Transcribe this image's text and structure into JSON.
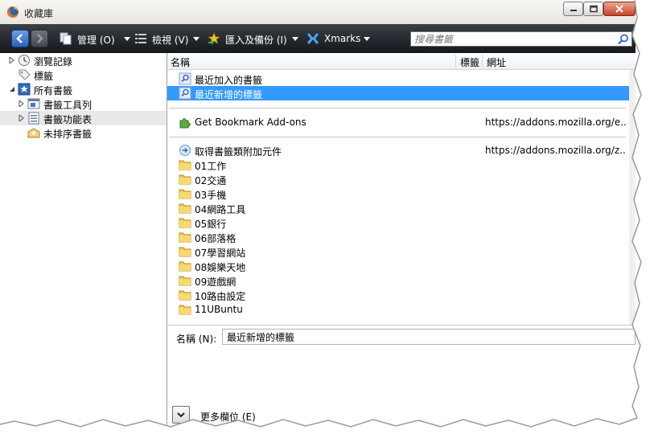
{
  "window": {
    "title": "收藏庫",
    "app_icon": "firefox-icon",
    "controls": [
      "minimize-icon",
      "maximize-icon",
      "close-icon"
    ]
  },
  "toolbar": {
    "back_icon": "back-arrow-icon",
    "forward_icon": "forward-arrow-icon",
    "organize_label": "管理 (O)",
    "views_label": "檢視 (V)",
    "import_backup_label": "匯入及備份 (I)",
    "xmarks_label": "Xmarks",
    "search_placeholder": "搜尋書籤",
    "search_icon": "magnifier-icon"
  },
  "sidebar": {
    "items": [
      {
        "label": "瀏覽記錄",
        "icon": "history-clock-icon",
        "expandable": true,
        "expanded": false,
        "indent": 0
      },
      {
        "label": "標籤",
        "icon": "tag-icon",
        "expandable": false,
        "indent": 0
      },
      {
        "label": "所有書籤",
        "icon": "bookmarks-star-icon",
        "expandable": true,
        "expanded": true,
        "indent": 0
      },
      {
        "label": "書籤工具列",
        "icon": "bookmarks-toolbar-icon",
        "expandable": true,
        "expanded": false,
        "indent": 1
      },
      {
        "label": "書籤功能表",
        "icon": "bookmarks-menu-icon",
        "expandable": true,
        "expanded": false,
        "indent": 1,
        "selected": true
      },
      {
        "label": "未排序書籤",
        "icon": "unsorted-bookmarks-icon",
        "expandable": false,
        "indent": 1
      }
    ]
  },
  "columns": {
    "name": "名稱",
    "tags": "標籤",
    "location": "網址"
  },
  "rows": [
    {
      "kind": "query",
      "name": "最近加入的書籤",
      "url": "",
      "icon": "smart-query-icon"
    },
    {
      "kind": "query",
      "name": "最近新增的標籤",
      "url": "",
      "icon": "smart-query-icon",
      "selected": true
    },
    {
      "kind": "separator"
    },
    {
      "kind": "bookmark",
      "name": "Get Bookmark Add-ons",
      "url": "https://addons.mozilla.org/e...",
      "icon": "puzzle-piece-icon"
    },
    {
      "kind": "separator"
    },
    {
      "kind": "bookmark",
      "name": "取得書籤類附加元件",
      "url": "https://addons.mozilla.org/z...",
      "icon": "globe-page-icon"
    },
    {
      "kind": "folder",
      "name": "01工作",
      "icon": "folder-icon"
    },
    {
      "kind": "folder",
      "name": "02交通",
      "icon": "folder-icon"
    },
    {
      "kind": "folder",
      "name": "03手機",
      "icon": "folder-icon"
    },
    {
      "kind": "folder",
      "name": "04網路工具",
      "icon": "folder-icon"
    },
    {
      "kind": "folder",
      "name": "05銀行",
      "icon": "folder-icon"
    },
    {
      "kind": "folder",
      "name": "06部落格",
      "icon": "folder-icon"
    },
    {
      "kind": "folder",
      "name": "07學習網站",
      "icon": "folder-icon"
    },
    {
      "kind": "folder",
      "name": "08娛樂天地",
      "icon": "folder-icon"
    },
    {
      "kind": "folder",
      "name": "09遊戲網",
      "icon": "folder-icon"
    },
    {
      "kind": "folder",
      "name": "10路由設定",
      "icon": "folder-icon"
    },
    {
      "kind": "folder",
      "name": "11UBuntu",
      "icon": "folder-icon"
    }
  ],
  "details": {
    "name_label": "名稱 (N):",
    "name_value": "最近新增的標籤",
    "more_label": "更多欄位 (E)",
    "more_icon": "chevron-down-icon"
  },
  "colors": {
    "selection": "#3399ff",
    "toolbar_dark": "#14171b",
    "folder": "#f3c94e"
  }
}
